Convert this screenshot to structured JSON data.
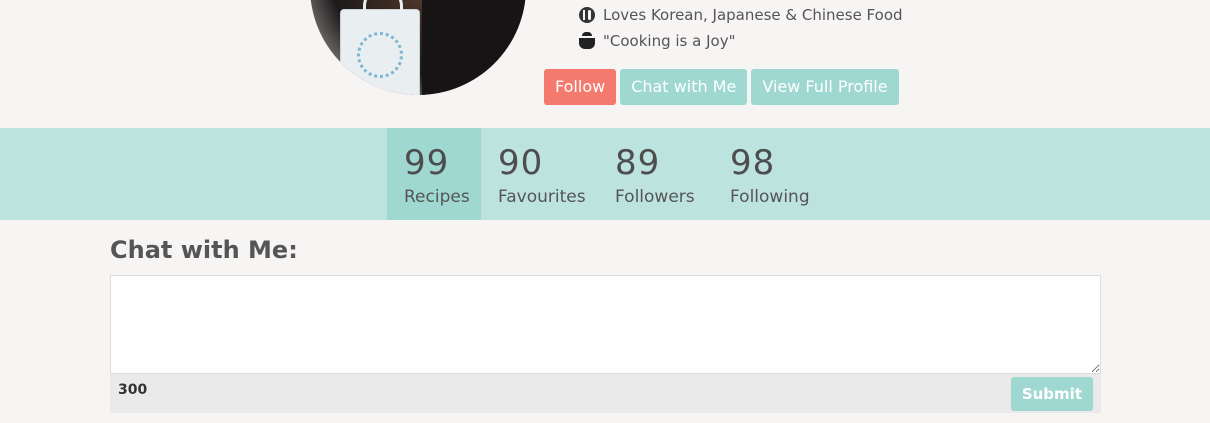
{
  "profile": {
    "info": [
      {
        "icon": "utensils-icon",
        "text": "Loves Korean, Japanese & Chinese Food"
      },
      {
        "icon": "cooking-pot-icon",
        "text": "\"Cooking is a Joy\""
      }
    ],
    "buttons": {
      "follow": "Follow",
      "chat": "Chat with Me",
      "view_profile": "View Full Profile"
    }
  },
  "stats": [
    {
      "value": "99",
      "label": "Recipes",
      "active": true
    },
    {
      "value": "90",
      "label": "Favourites",
      "active": false
    },
    {
      "value": "89",
      "label": "Followers",
      "active": false
    },
    {
      "value": "98",
      "label": "Following",
      "active": false
    }
  ],
  "chat": {
    "heading": "Chat with Me:",
    "message_value": "",
    "char_count": "300",
    "submit_label": "Submit"
  },
  "colors": {
    "accent_teal": "#9fd8d1",
    "stats_bar": "#bde3df",
    "follow_coral": "#f47a6e",
    "background": "#f7f4f4"
  }
}
